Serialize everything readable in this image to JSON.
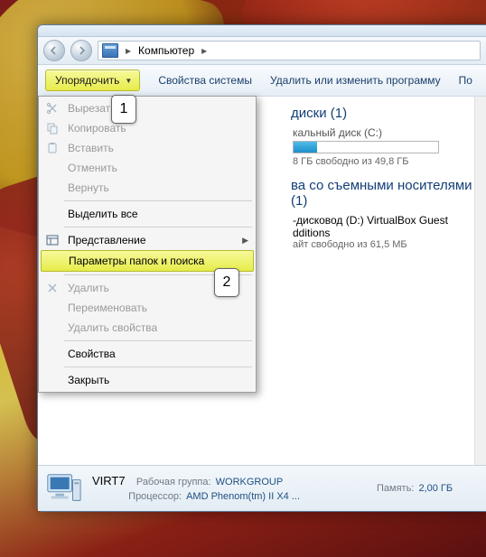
{
  "breadcrumb": {
    "root": "Компьютер",
    "arrow": "▸"
  },
  "toolbar": {
    "organize_label": "Упорядочить",
    "links": [
      "Свойства системы",
      "Удалить или изменить программу",
      "По"
    ]
  },
  "menu": {
    "items": [
      {
        "id": "cut",
        "label": "Вырезать",
        "icon": "scissors",
        "disabled": true
      },
      {
        "id": "copy",
        "label": "Копировать",
        "icon": "copy",
        "disabled": true
      },
      {
        "id": "paste",
        "label": "Вставить",
        "icon": "paste",
        "disabled": true
      },
      {
        "id": "undo",
        "label": "Отменить",
        "icon": "",
        "disabled": true
      },
      {
        "id": "redo",
        "label": "Вернуть",
        "icon": "",
        "disabled": true
      }
    ],
    "select_all": {
      "label": "Выделить все"
    },
    "layout": {
      "label": "Представление",
      "icon": "layout"
    },
    "folder_opts": {
      "label": "Параметры папок и поиска"
    },
    "items3": [
      {
        "id": "delete",
        "label": "Удалить",
        "icon": "delete-x",
        "disabled": true
      },
      {
        "id": "rename",
        "label": "Переименовать",
        "icon": "",
        "disabled": true
      },
      {
        "id": "delprops",
        "label": "Удалить свойства",
        "icon": "",
        "disabled": true
      }
    ],
    "properties": {
      "label": "Свойства"
    },
    "close": {
      "label": "Закрыть"
    }
  },
  "callouts": {
    "one": "1",
    "two": "2"
  },
  "content": {
    "hdd_title": "диски (1)",
    "hdd_label": "кальный диск (C:)",
    "hdd_sub": "8 ГБ свободно из 49,8 ГБ",
    "rm_title": "ва со съемными носителями (1)",
    "dvd_name": "-дисковод (D:) VirtualBox Guest",
    "dvd_name2": "dditions",
    "dvd_sub": "айт свободно из 61,5 МБ"
  },
  "details": {
    "name": "VIRT7",
    "wg_label": "Рабочая группа:",
    "wg_value": "WORKGROUP",
    "cpu_label": "Процессор:",
    "cpu_value": "AMD Phenom(tm) II X4 ...",
    "mem_label": "Память:",
    "mem_value": "2,00 ГБ"
  }
}
